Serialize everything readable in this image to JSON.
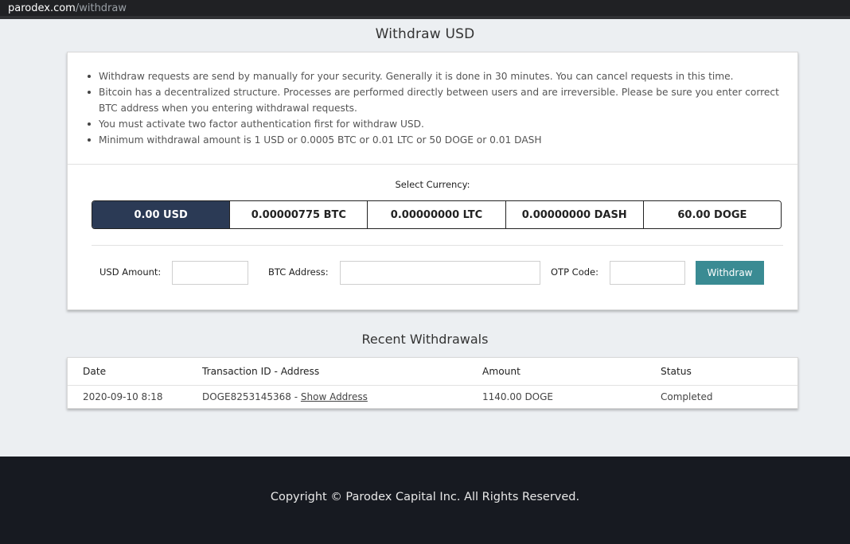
{
  "browser": {
    "domain": "parodex.com",
    "path": "/withdraw"
  },
  "page_title": "Withdraw USD",
  "notes": [
    "Withdraw requests are send by manually for your security. Generally it is done in 30 minutes. You can cancel requests in this time.",
    "Bitcoin has a decentralized structure. Processes are performed directly between users and are irreversible. Please be sure you enter correct BTC address when you entering withdrawal requests.",
    "You must activate two factor authentication first for withdraw USD.",
    "Minimum withdrawal amount is 1 USD or 0.0005 BTC or 0.01 LTC or 50 DOGE or 0.01 DASH"
  ],
  "select_currency_label": "Select Currency:",
  "currencies": [
    {
      "label": "0.00 USD",
      "active": true
    },
    {
      "label": "0.00000775 BTC",
      "active": false
    },
    {
      "label": "0.00000000 LTC",
      "active": false
    },
    {
      "label": "0.00000000 DASH",
      "active": false
    },
    {
      "label": "60.00 DOGE",
      "active": false
    }
  ],
  "form": {
    "amount_label": "USD Amount:",
    "address_label": "BTC Address:",
    "otp_label": "OTP Code:",
    "amount_value": "",
    "address_value": "",
    "otp_value": "",
    "submit_label": "Withdraw"
  },
  "recent_title": "Recent Withdrawals",
  "table": {
    "headers": [
      "Date",
      "Transaction ID - Address",
      "Amount",
      "Status"
    ],
    "rows": [
      {
        "date": "2020-09-10 8:18",
        "txid": "DOGE8253145368 - ",
        "address_link": "Show Address",
        "amount": "1140.00 DOGE",
        "status": "Completed"
      }
    ]
  },
  "footer": "Copyright © Parodex Capital Inc. All Rights Reserved.",
  "colors": {
    "accent": "#3a8b93",
    "active_currency": "#2b3a55",
    "footer_bg": "#171a21"
  }
}
